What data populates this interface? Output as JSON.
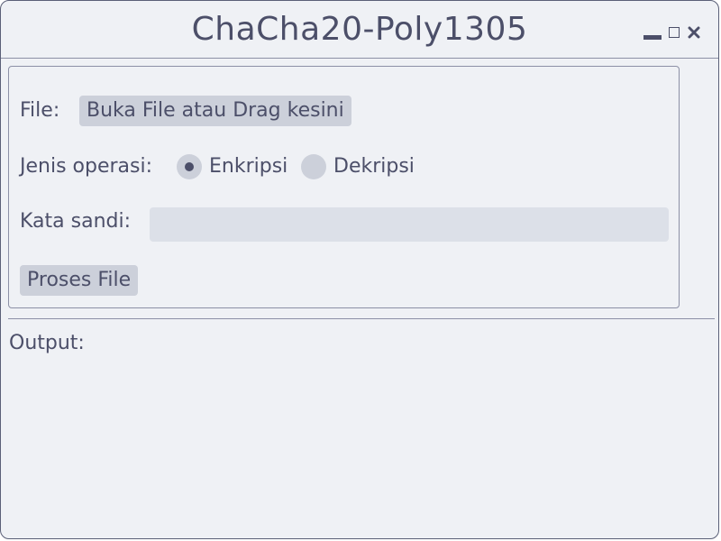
{
  "window": {
    "title": "ChaCha20-Poly1305",
    "controls": [
      "minimize-icon",
      "maximize-icon",
      "close-icon"
    ]
  },
  "form": {
    "file_label": "File:",
    "open_file_button": "Buka File atau Drag kesini",
    "operation_label": "Jenis operasi:",
    "operations": [
      {
        "label": "Enkripsi",
        "selected": true
      },
      {
        "label": "Dekripsi",
        "selected": false
      }
    ],
    "password_label": "Kata sandi:",
    "password_value": "",
    "process_button": "Proses File"
  },
  "output": {
    "label": "Output:"
  },
  "colors": {
    "background": "#eff1f5",
    "text": "#4c4f69",
    "button": "#ccd0da",
    "input": "#dce0e8",
    "border": "#8c90a6"
  }
}
